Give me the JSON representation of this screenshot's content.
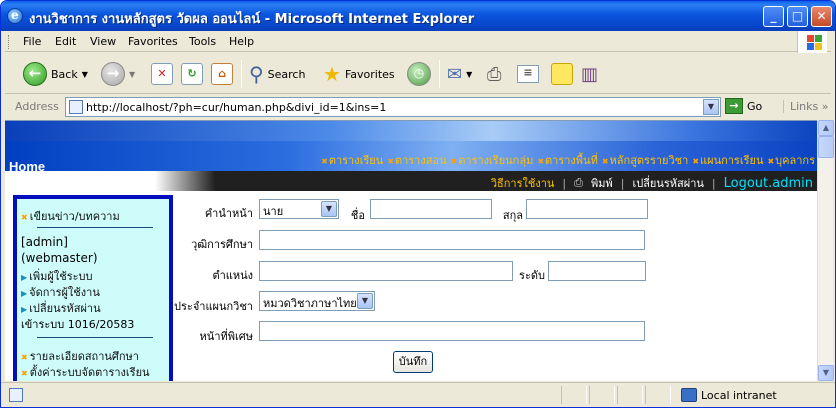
{
  "window": {
    "title": "งานวิชาการ งานหลักสูตร วัดผล ออนไลน์ - Microsoft Internet Explorer",
    "controls": {
      "minimize": "_",
      "maximize": "□",
      "close": "✕"
    }
  },
  "menubar": {
    "items": [
      {
        "label": "File"
      },
      {
        "label": "Edit"
      },
      {
        "label": "View"
      },
      {
        "label": "Favorites"
      },
      {
        "label": "Tools"
      },
      {
        "label": "Help"
      }
    ]
  },
  "toolbar": {
    "back_label": "Back",
    "search_label": "Search",
    "favorites_label": "Favorites"
  },
  "address": {
    "label": "Address",
    "url": "http://localhost/?ph=cur/human.php&divi_id=1&ins=1",
    "go_label": "Go",
    "links_label": "Links"
  },
  "site": {
    "home_label": "Home",
    "nav": [
      "ตารางเรียน",
      "ตารางสอน",
      "ตารางเรียนกลุ่ม",
      "ตารางพื้นที่",
      "หลักสูตรรายวิชา",
      "แผนการเรียน",
      "บุคลากร"
    ],
    "subnav": {
      "manual": "วิธีการใช้งาน",
      "print": "พิมพ์",
      "change_password": "เปลี่ยนรหัสผ่าน",
      "logout": "Logout.admin"
    }
  },
  "sidebar": {
    "write_news": "เขียนข่าว/บทความ",
    "user_line1": "[admin]",
    "user_line2": "(webmaster)",
    "add_user": "เพิ่มผู้ใช้ระบบ",
    "manage_users": "จัดการผู้ใช้งาน",
    "change_password": "เปลี่ยนรหัสผ่าน",
    "login_count": "เข้าระบบ 1016/20583",
    "school_info": "รายละเอียดสถานศึกษา",
    "schedule_settings": "ตั้งค่าระบบจัดตารางเรียน"
  },
  "form": {
    "prefix_label": "คำนำหน้า",
    "prefix_value": "นาย",
    "firstname_label": "ชื่อ",
    "lastname_label": "สกุล",
    "education_label": "วุฒิการศึกษา",
    "position_label": "ตำแหน่ง",
    "level_label": "ระดับ",
    "department_label": "ประจำแผนกวิชา",
    "department_value": "หมวดวิชาภาษาไทย",
    "duty_label": "หน้าที่พิเศษ",
    "submit_label": "บันทึก"
  },
  "statusbar": {
    "zone": "Local intranet"
  }
}
